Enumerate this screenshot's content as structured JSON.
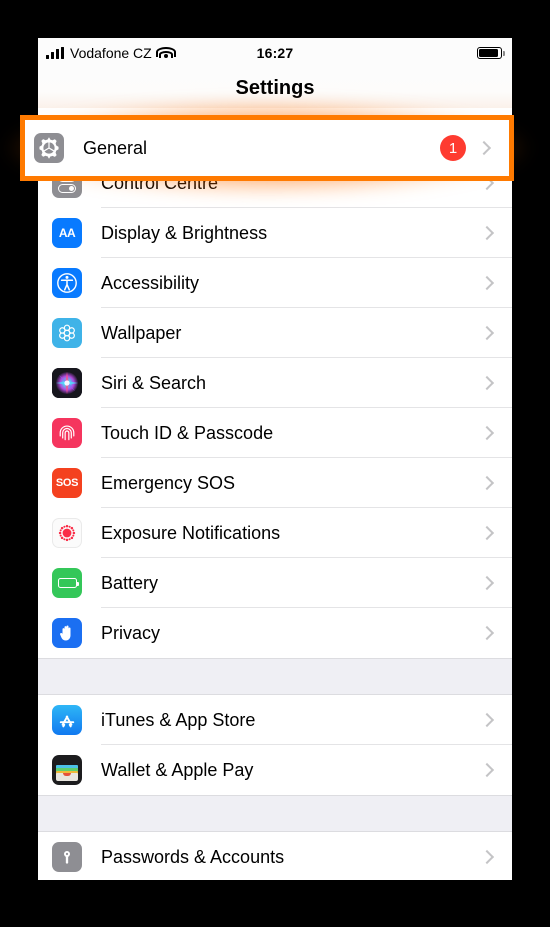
{
  "status_bar": {
    "carrier": "Vodafone CZ",
    "time": "16:27",
    "signal_icon": "cellular-bars-icon",
    "wifi_icon": "wifi-icon",
    "battery_icon": "battery-icon"
  },
  "nav": {
    "title": "Settings"
  },
  "highlight": {
    "color": "#ff7a00",
    "target_row": "General"
  },
  "groups": [
    {
      "rows": [
        {
          "label": "General",
          "icon": "gear-icon",
          "badge": "1",
          "highlighted": true
        },
        {
          "label": "Control Centre",
          "icon": "control-centre-icon"
        },
        {
          "label": "Display & Brightness",
          "icon": "display-brightness-icon"
        },
        {
          "label": "Accessibility",
          "icon": "accessibility-icon"
        },
        {
          "label": "Wallpaper",
          "icon": "wallpaper-icon"
        },
        {
          "label": "Siri & Search",
          "icon": "siri-icon"
        },
        {
          "label": "Touch ID & Passcode",
          "icon": "touch-id-icon"
        },
        {
          "label": "Emergency SOS",
          "icon": "sos-icon"
        },
        {
          "label": "Exposure Notifications",
          "icon": "exposure-notifications-icon"
        },
        {
          "label": "Battery",
          "icon": "battery-settings-icon"
        },
        {
          "label": "Privacy",
          "icon": "privacy-hand-icon"
        }
      ]
    },
    {
      "rows": [
        {
          "label": "iTunes & App Store",
          "icon": "app-store-icon"
        },
        {
          "label": "Wallet & Apple Pay",
          "icon": "wallet-icon"
        }
      ]
    },
    {
      "rows": [
        {
          "label": "Passwords & Accounts",
          "icon": "passwords-icon"
        }
      ]
    }
  ]
}
